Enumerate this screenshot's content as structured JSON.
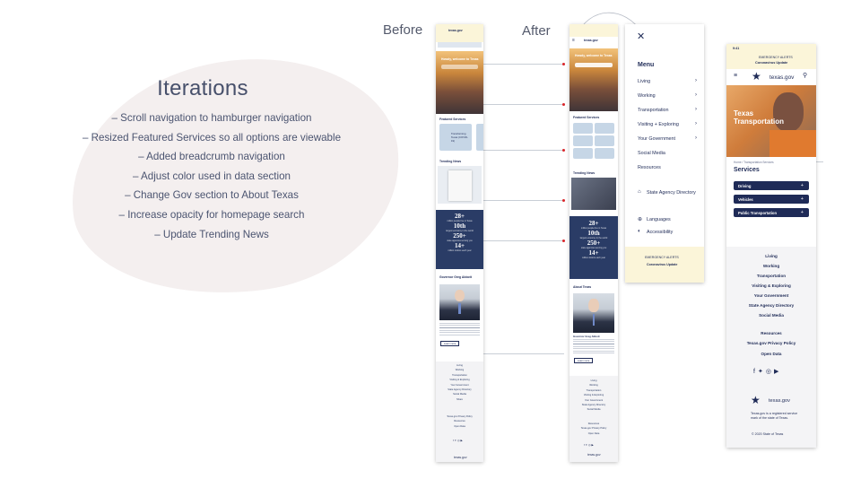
{
  "iterations": {
    "title": "Iterations",
    "items": [
      "– Scroll navigation to hamburger navigation",
      "– Resized Featured Services so all options are viewable",
      "– Added breadcrumb navigation",
      "– Adjust color used in data section",
      "– Change Gov section to About Texas",
      "– Increase opacity for homepage search",
      "– Update Trending News"
    ]
  },
  "labels": {
    "before": "Before",
    "after": "After"
  },
  "before_phone": {
    "logo": "texas.gov",
    "hero": "Howdy, welcome to Texas",
    "featured_title": "Featured Services",
    "featured_item": "Transforming Texas (COVID-19)",
    "trending_title": "Trending News",
    "stats": [
      {
        "num": "28+",
        "cap": "million people live in Texas"
      },
      {
        "num": "10th",
        "cap": "largest economy in the world"
      },
      {
        "num": "250+",
        "cap": "state agencies serving you"
      },
      {
        "num": "14+",
        "cap": "million visitors each year"
      }
    ],
    "gov_title": "Governor Greg Abbott",
    "learn_more": "Learn more",
    "footer_links": [
      "Living",
      "Working",
      "Transportation",
      "Visiting & Exploring",
      "Your Government",
      "State Agency Directory",
      "Social Media",
      "Share"
    ],
    "footer_links2": [
      "Texas.gov Privacy Policy",
      "Resources",
      "Open Data"
    ],
    "logo2": "texas.gov"
  },
  "after_phone": {
    "logo": "texas.gov",
    "hero": "Howdy, welcome to Texas",
    "featured_title": "Featured Services",
    "trending_title": "Trending News",
    "stats": [
      {
        "num": "28+",
        "cap": "million people live in Texas"
      },
      {
        "num": "10th",
        "cap": "largest economy in the world"
      },
      {
        "num": "250+",
        "cap": "state agencies serving you"
      },
      {
        "num": "14+",
        "cap": "million visitors each year"
      }
    ],
    "about_title": "About Texas",
    "gov_name": "Governor Greg Abbott",
    "learn_more": "Learn more",
    "footer_links": [
      "Living",
      "Working",
      "Transportation",
      "Visiting & Exploring",
      "Your Government",
      "State Agency Directory",
      "Social Media"
    ],
    "footer_links2": [
      "Resources",
      "Texas.gov Privacy Policy",
      "Open Data"
    ],
    "logo2": "texas.gov"
  },
  "menu": {
    "title": "Menu",
    "items": [
      {
        "label": "Living",
        "chevron": true
      },
      {
        "label": "Working",
        "chevron": true
      },
      {
        "label": "Transportation",
        "chevron": true
      },
      {
        "label": "Visiting + Exploring",
        "chevron": true
      },
      {
        "label": "Your Government",
        "chevron": true
      },
      {
        "label": "Social Media",
        "chevron": false
      },
      {
        "label": "Resources",
        "chevron": false
      }
    ],
    "directory": "State Agency Directory",
    "languages": "Languages",
    "accessibility": "Accessibility",
    "alert_line1": "EMERGENCY ALERTS",
    "alert_line2": "Coronavirus Update"
  },
  "final_phone": {
    "time": "9:41",
    "alert_line1": "EMERGENCY ALERTS",
    "alert_line2": "Coronavirus Update",
    "logo": "texas.gov",
    "hero_title": "Texas Transportation",
    "breadcrumb": "Home / Transportation Services",
    "services_title": "Services",
    "services": [
      "Driving",
      "Vehicles",
      "Public Transportation"
    ],
    "footer_links": [
      "Living",
      "Working",
      "Transportation",
      "Visiting & Exploring",
      "Your Government",
      "State Agency Directory",
      "Social Media"
    ],
    "footer_links2": [
      "Resources",
      "Texas.gov Privacy Policy",
      "Open Data"
    ],
    "logo2": "texas.gov",
    "trademark": "Texas.gov is a registered service mark of the state of Texas.",
    "copyright": "2020 State of Texas"
  },
  "colors": {
    "navy": "#1f2b57",
    "stats_bg": "#2a3c66",
    "accent_red": "#d9262a",
    "blob": "#f4efef"
  }
}
